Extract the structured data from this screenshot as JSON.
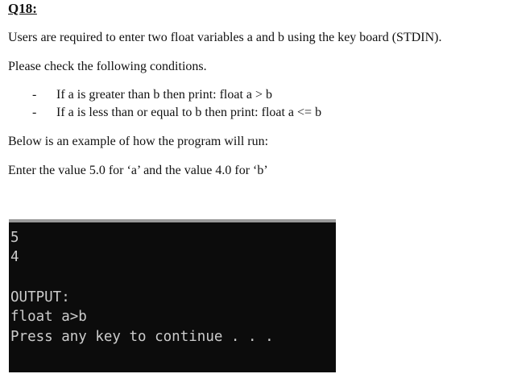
{
  "question": {
    "heading": "Q18:",
    "intro": "Users are required to enter two float variables a and b using the key board (STDIN).",
    "instruction": "Please check the following conditions.",
    "conditions": [
      "If a is greater than b then print: float a >  b",
      "If a is less than or equal to b then print: float a <= b"
    ],
    "example_intro": "Below is an example of how the program will run:",
    "example_values": "Enter the value 5.0 for ‘a’ and the value 4.0 for ‘b’"
  },
  "console": {
    "lines": [
      "5",
      "4",
      "OUTPUT:",
      "float a>b",
      "Press any key to continue . . ."
    ]
  }
}
